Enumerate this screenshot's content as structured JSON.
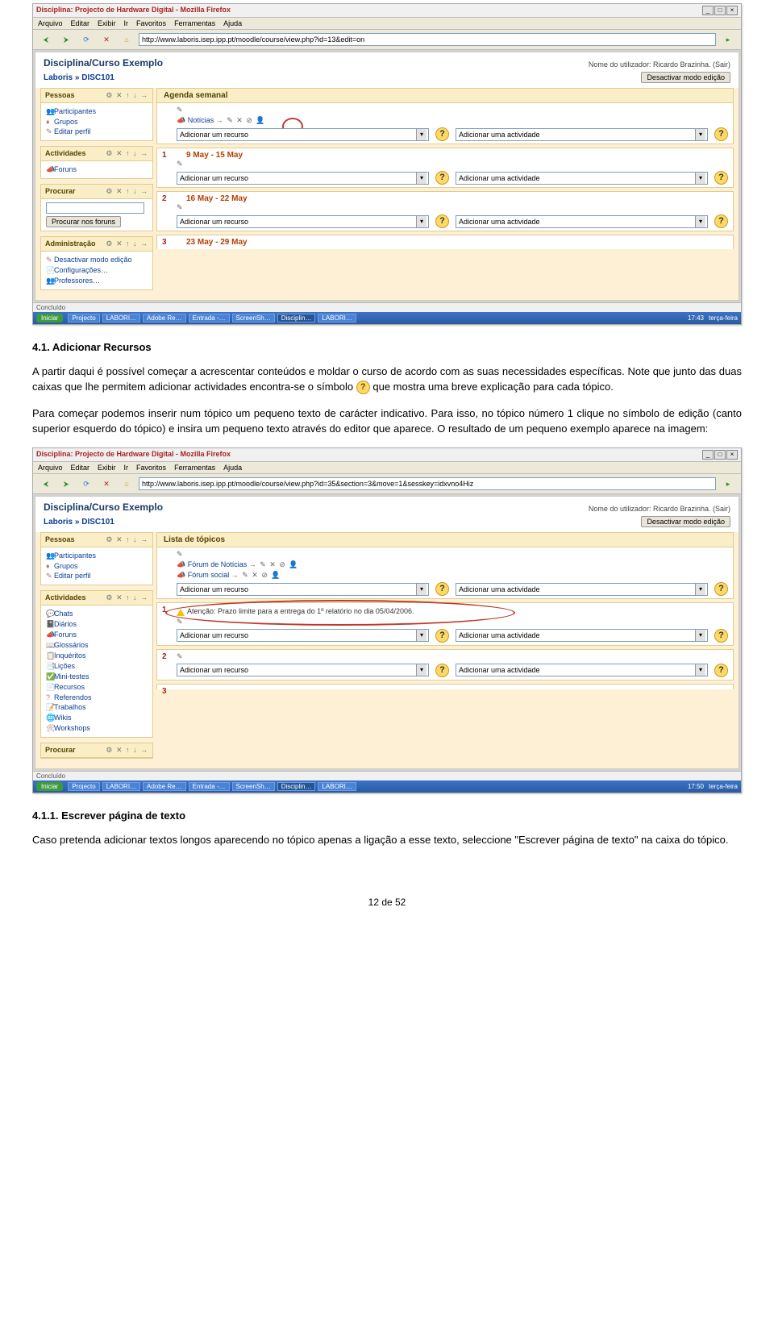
{
  "shot1": {
    "titlebar": "Disciplina: Projecto de Hardware Digital - Mozilla Firefox",
    "menubar": [
      "Arquivo",
      "Editar",
      "Exibir",
      "Ir",
      "Favoritos",
      "Ferramentas",
      "Ajuda"
    ],
    "url": "http://www.laboris.isep.ipp.pt/moodle/course/view.php?id=13&edit=on",
    "course_title": "Disciplina/Curso Exemplo",
    "user_line": "Nome do utilizador:  Ricardo Brazinha.  (Sair)",
    "breadcrumb": "Laboris » DISC101",
    "edit_button": "Desactivar modo edição",
    "sidebar": {
      "pessoas": {
        "title": "Pessoas",
        "items": [
          "Participantes",
          "Grupos",
          "Editar perfil"
        ]
      },
      "actividades": {
        "title": "Actividades",
        "items": [
          "Foruns"
        ]
      },
      "procurar": {
        "title": "Procurar",
        "button": "Procurar nos foruns"
      },
      "admin": {
        "title": "Administração",
        "items": [
          "Desactivar modo edição",
          "Configurações…",
          "Professores…"
        ]
      }
    },
    "center_title": "Agenda semanal",
    "topic0_item": "Notícias",
    "dd_recurso": "Adicionar um recurso",
    "dd_actividade": "Adicionar uma actividade",
    "weeks": [
      {
        "n": "1",
        "label": "9 May - 15 May"
      },
      {
        "n": "2",
        "label": "16 May - 22 May"
      },
      {
        "n": "3",
        "label": "23 May - 29 May"
      }
    ],
    "tabs_label": "Concluído",
    "taskbar": {
      "start": "Iniciar",
      "tasks": [
        "Projecto",
        "LABORI…",
        "Adobe Re…",
        "Entrada -…",
        "ScreenSh…",
        "Disciplin…",
        "LABORI…"
      ],
      "clock": "17:43",
      "date": "terça-feira"
    }
  },
  "doc": {
    "h41": "4.1. Adicionar Recursos",
    "p1": "A partir daqui é possível começar a acrescentar conteúdos e moldar o curso de acordo com as suas necessidades específicas. Note que junto das duas caixas que lhe permitem adicionar actividades encontra-se o símbolo ",
    "p1b": " que mostra uma breve explicação para cada tópico.",
    "p2": "Para começar podemos inserir num tópico um pequeno texto de carácter indicativo. Para isso, no tópico número 1 clique no símbolo de edição (canto superior esquerdo do tópico) e insira um pequeno texto através do editor que aparece. O resultado de um pequeno exemplo aparece na imagem:",
    "h411": "4.1.1. Escrever página de texto",
    "p3": "Caso pretenda adicionar textos longos aparecendo no tópico apenas a ligação a esse texto, seleccione \"Escrever página de texto\" na caixa do tópico.",
    "page_num": "12 de 52"
  },
  "shot2": {
    "titlebar": "Disciplina: Projecto de Hardware Digital - Mozilla Firefox",
    "url": "http://www.laboris.isep.ipp.pt/moodle/course/view.php?id=35&section=3&move=1&sesskey=idxvno4Hiz",
    "course_title": "Disciplina/Curso Exemplo",
    "user_line": "Nome do utilizador:  Ricardo Brazinha.  (Sair)",
    "breadcrumb": "Laboris » DISC101",
    "edit_button": "Desactivar modo edição",
    "center_title": "Lista de tópicos",
    "sidebar": {
      "pessoas": {
        "title": "Pessoas",
        "items": [
          "Participantes",
          "Grupos",
          "Editar perfil"
        ]
      },
      "actividades": {
        "title": "Actividades",
        "items": [
          "Chats",
          "Diários",
          "Foruns",
          "Glossários",
          "Inquéritos",
          "Lições",
          "Mini-testes",
          "Recursos",
          "Referendos",
          "Trabalhos",
          "Wikis",
          "Workshops"
        ]
      },
      "procurar": {
        "title": "Procurar"
      }
    },
    "topic0_items": [
      "Fórum de Notícias",
      "Fórum social"
    ],
    "topic1_text": "Atenção: Prazo limite para a entrega do 1º relatório no dia 05/04/2006.",
    "dd_recurso": "Adicionar um recurso",
    "dd_actividade": "Adicionar uma actividade",
    "topics": [
      "1",
      "2",
      "3"
    ],
    "taskbar": {
      "start": "Iniciar",
      "tasks": [
        "Projecto",
        "LABORI…",
        "Adobe Re…",
        "Entrada -…",
        "ScreenSh…",
        "Disciplin…",
        "LABORI…"
      ],
      "clock": "17:50",
      "date": "terça-feira"
    }
  }
}
